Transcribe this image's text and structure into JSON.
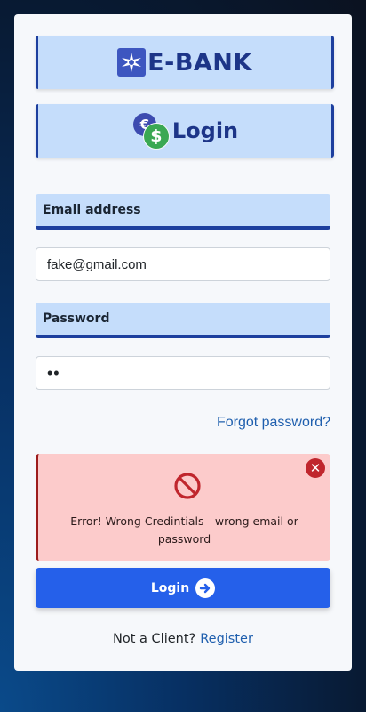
{
  "brand": {
    "name": "E-BANK",
    "icon": "star-burst-logo-icon"
  },
  "header": {
    "title": "Login",
    "icon": "currency-coins-icon"
  },
  "email": {
    "label": "Email address",
    "value": "fake@gmail.com"
  },
  "password": {
    "label": "Password",
    "value": "••"
  },
  "forgot_link": "Forgot password?",
  "alert": {
    "message": "Error!  Wrong Credintials - wrong email or password",
    "icon": "prohibited-icon",
    "close_icon": "close-icon"
  },
  "login_button": {
    "label": "Login",
    "icon": "arrow-right-circle-icon"
  },
  "footer": {
    "prompt": "Not a Client?",
    "register_label": "Register"
  },
  "colors": {
    "accent": "#2560ea",
    "banner_bg": "#c5ddfb",
    "banner_border": "#1d3f9e",
    "error_bg": "#fccbcb",
    "error_icon": "#c0262d"
  }
}
